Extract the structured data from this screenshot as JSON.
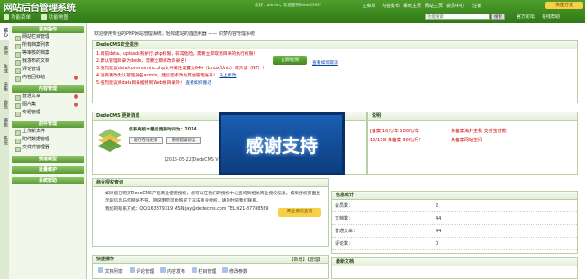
{
  "header": {
    "title": "网站后台管理系统",
    "sub_links": [
      "功能菜单",
      "功能地图"
    ],
    "welcome": "您好：admin，欢迎使用DedeCMS！",
    "nav": [
      "主菜单",
      "内容发布",
      "系统主页",
      "网站主页",
      "会员中心",
      "注销"
    ],
    "quick": "快捷方式",
    "search_placeholder": "功能搜索",
    "search_btn": "搜索",
    "top_links": [
      "官方论坛",
      "在线帮助"
    ]
  },
  "left_tabs": [
    "核心",
    "模块",
    "生成",
    "采集",
    "会员",
    "模板",
    "系统"
  ],
  "sidebar": {
    "groups": [
      {
        "title": "常用操作",
        "items": [
          "网站栏目管理",
          "所有档案列表",
          "等审核的档案",
          "我发布的文档",
          "评论管理",
          "内容回收站"
        ]
      },
      {
        "title": "内容管理",
        "items": [
          "普通文章",
          "图片集",
          "专题管理"
        ]
      },
      {
        "title": "附件管理",
        "items": [
          "上传新文件",
          "附件数据管理",
          "文件式管理器"
        ]
      },
      {
        "title": "频道模型",
        "items": []
      },
      {
        "title": "批量维护",
        "items": []
      },
      {
        "title": "系统帮助",
        "items": []
      }
    ]
  },
  "main": {
    "crumb": "欢迎使用专业的PHP网站管理系统，轻松建站的首选利器 —— 织梦内容管理系统",
    "security": {
      "title": "DedeCMS安全提示",
      "lines": [
        "1.目前data、uploads有执行.php权限，非常危险，需要立即取消目录的执行权限！",
        "2.默认管理目录为dede，需要立即修改目录名！",
        "3.强烈建议data/common.inc.php文件属性设置为644（Linux/Unix）或只读（NT）！",
        "4.没有更改默认管理员名admin，建议您修改为其他管理账号！",
        "5.强烈建议将data目录搬移到Web根目录外！"
      ],
      "links": [
        "马上修改",
        "查看如何搬迁"
      ],
      "check_btn": "立即检测",
      "cancel_link": "查看如何取消"
    },
    "update": {
      "title": "DedeCMS 更新消息",
      "text": "您系统版本最后更新时间为：2014",
      "btns": [
        "进行在线更新",
        "系统错误修复"
      ],
      "log": "[2015-05-22]DedeCMS V5.7 SP1"
    },
    "ad": {
      "title": "说明",
      "line1": "[备案]10元/年 100元/年",
      "line2": "15/15G 免备案 90元/月！",
      "right1": "免备案海外主机 支付宝付款",
      "right2": "免备案网站空间"
    },
    "biz": {
      "title": "商业授权查询",
      "text": "如果您已购买DedeCMS产品商业使用授权，您可以在我们的授权中心查询到相关商业授权信息，如果授权页面显示的信息与您网站不符，则说明您可能购买了非法商业授权，请及时同我们联系。",
      "contact": "我们的联系方式：QQ:163879319 MSN:jay@dedecms.com TEL:021-37788569",
      "btn": "商业授权查询"
    },
    "stats": {
      "title": "信息统计",
      "rows": [
        {
          "label": "会员数：",
          "value": "2"
        },
        {
          "label": "文档数：",
          "value": "44"
        },
        {
          "label": "普通文章：",
          "value": "44"
        },
        {
          "label": "评论数：",
          "value": "0"
        }
      ]
    },
    "quick_ops": {
      "title": "快捷操作",
      "links": [
        "【新增】",
        "【管理】"
      ],
      "items": [
        "文档列表",
        "评论管理",
        "内容发布",
        "栏目管理",
        "修改参数"
      ]
    },
    "latest": {
      "title": "最新文档"
    }
  },
  "overlay": {
    "text": "感谢支持"
  },
  "colors": {
    "header": "#3c8a1f",
    "accent": "#c00000",
    "sidebar": "#f2f7ec"
  }
}
